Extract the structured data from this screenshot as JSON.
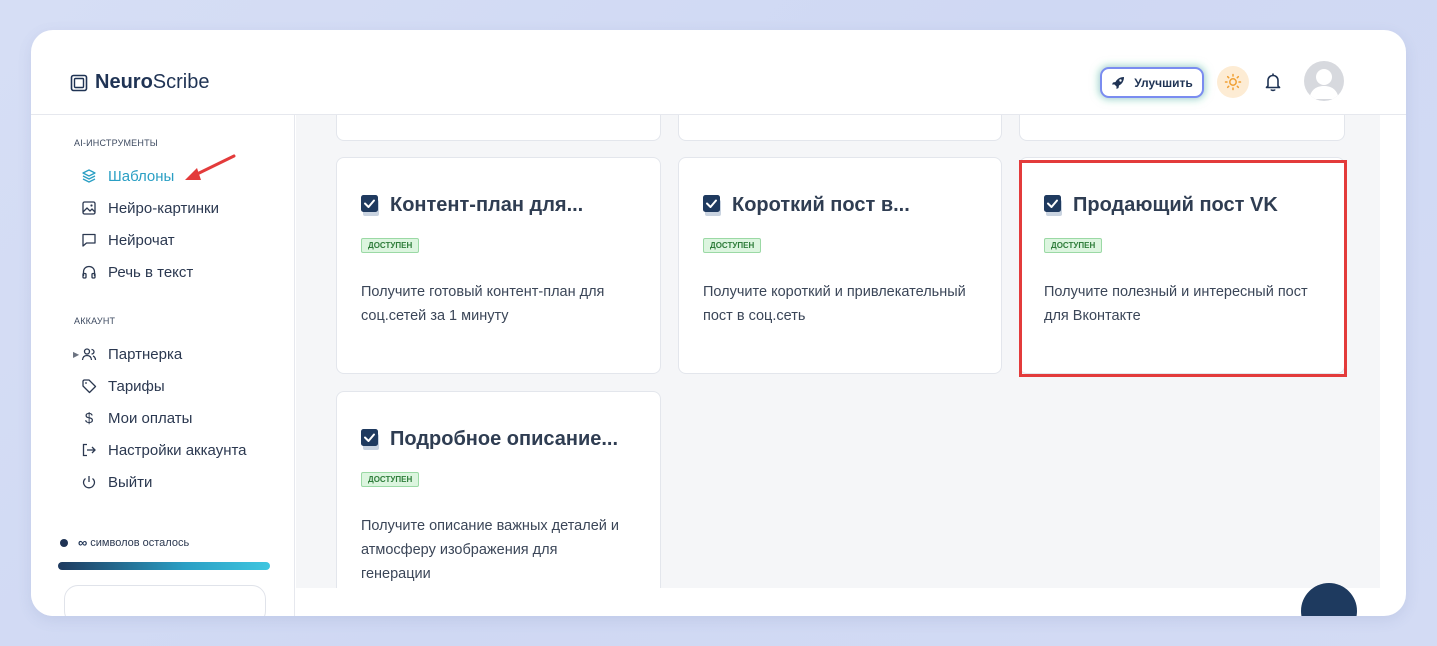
{
  "app": {
    "logo_bold": "Neuro",
    "logo_regular": "Scribe"
  },
  "header": {
    "upgrade_label": "Улучшить"
  },
  "sidebar": {
    "section_tools": "AI-ИНСТРУМЕНТЫ",
    "tools": [
      {
        "label": "Шаблоны",
        "icon": "layers-icon",
        "active": true
      },
      {
        "label": "Нейро-картинки",
        "icon": "image-icon"
      },
      {
        "label": "Нейрочат",
        "icon": "chat-icon"
      },
      {
        "label": "Речь в текст",
        "icon": "headphones-icon"
      }
    ],
    "section_account": "АККАУНТ",
    "account": [
      {
        "label": "Партнерка",
        "icon": "users-icon"
      },
      {
        "label": "Тарифы",
        "icon": "tag-icon"
      },
      {
        "label": "Мои оплаты",
        "icon": "dollar-icon"
      },
      {
        "label": "Настройки аккаунта",
        "icon": "login-icon"
      },
      {
        "label": "Выйти",
        "icon": "power-icon"
      }
    ],
    "counter_symbol": "∞",
    "counter_text": "символов осталось"
  },
  "cards": [
    {
      "title": "Контент-план для...",
      "badge": "ДОСТУПЕН",
      "description": "Получите готовый контент-план для соц.сетей за 1 минуту"
    },
    {
      "title": "Короткий пост в...",
      "badge": "ДОСТУПЕН",
      "description": "Получите короткий и привлекательный пост в соц.сеть"
    },
    {
      "title": "Продающий пост VK",
      "badge": "ДОСТУПЕН",
      "description": "Получите полезный и интересный пост для Вконтакте"
    },
    {
      "title": "Подробное описание...",
      "badge": "ДОСТУПЕН",
      "description": "Получите описание важных деталей и атмосферу изображения для генерации"
    }
  ],
  "colors": {
    "accent": "#2a9fc4",
    "brand_dark": "#1f3354",
    "highlight": "#e33b3b",
    "badge_bg": "#dcf5df"
  }
}
